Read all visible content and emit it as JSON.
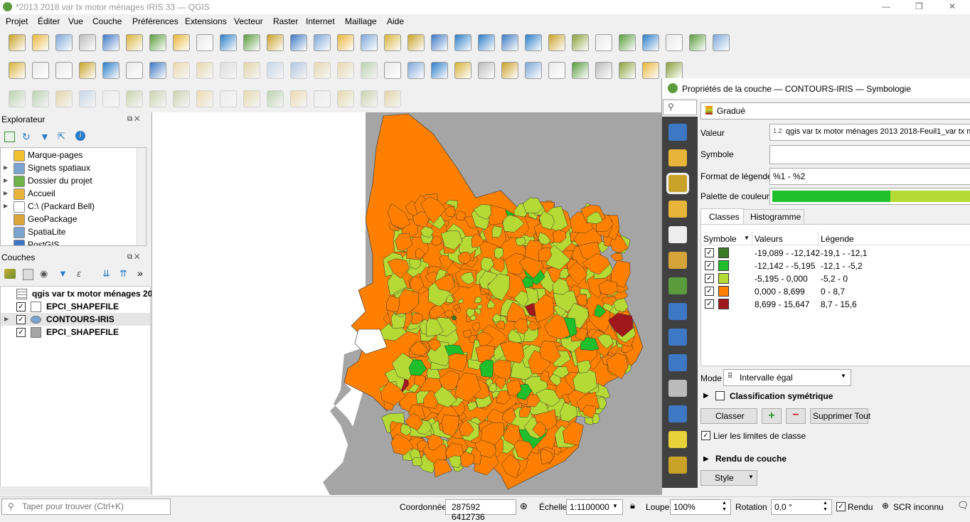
{
  "window": {
    "title": "*2013 2018 var tx motor ménages IRIS 33 — QGIS",
    "restore": "❐",
    "close": "✕"
  },
  "menu": [
    "Projet",
    "Éditer",
    "Vue",
    "Couche",
    "Préférences",
    "Extensions",
    "Vecteur",
    "Raster",
    "Internet",
    "Maillage",
    "Aide"
  ],
  "toolbar_icons": {
    "row1": [
      "new-project-icon",
      "open-project-icon",
      "save-project-icon",
      "save-as-icon",
      "print-layout-icon",
      "style-manager-icon",
      "pan-icon",
      "pan-to-selection-icon",
      "zoom-in-icon",
      "zoom-out-icon",
      "zoom-full-icon",
      "zoom-layer-icon",
      "zoom-selection-icon",
      "zoom-native-icon",
      "zoom-last-icon",
      "zoom-next-icon",
      "new-bookmark-icon",
      "show-bookmarks-icon",
      "map-tips-icon",
      "temporal-icon",
      "refresh-icon",
      "select-features-icon",
      "attribute-table-icon",
      "deselect-icon",
      "identify-icon",
      "statistics-icon",
      "sum-icon",
      "open-table-icon",
      "measure-icon",
      "annotation-icon",
      "gear-icon"
    ],
    "row2": [
      "datasource-manager-icon",
      "new-geopackage-icon",
      "new-shapefile-icon",
      "digitize-icon",
      "virtual-layer-icon",
      "temp-layer-icon",
      "mesh-layer-icon",
      "pencil-icon",
      "save-edits-icon",
      "add-feature-icon",
      "vertex-tool-icon",
      "cut-icon",
      "copy-icon",
      "paste-icon",
      "undo-icon",
      "redo-icon",
      "label-abc-icon",
      "diagram-icon",
      "label-pin-icon",
      "label-red-icon",
      "label-show-icon",
      "label-move-icon",
      "label-rotate-icon",
      "label-change-icon",
      "label-highlight-icon",
      "globe-icon",
      "globe2-icon",
      "python-icon",
      "help-icon"
    ],
    "row3": [
      "advanced-digitizing-icon",
      "add-ring-icon",
      "fill-ring-icon",
      "delete-ring-icon",
      "delete-part-icon",
      "reshape-icon",
      "offset-icon",
      "split-icon",
      "merge-icon",
      "rotate-icon",
      "simplify-icon",
      "add-part-icon",
      "split-parts-icon",
      "rotate-point-icon",
      "trim-icon",
      "reverse-icon",
      "angle-icon"
    ]
  },
  "explorer": {
    "title": "Explorateur",
    "items": [
      {
        "label": "Marque-pages",
        "icon": "star-icon",
        "expandable": false
      },
      {
        "label": "Signets spatiaux",
        "icon": "bookmark-icon",
        "expandable": true
      },
      {
        "label": "Dossier du projet",
        "icon": "project-folder-icon",
        "expandable": true
      },
      {
        "label": "Accueil",
        "icon": "home-folder-icon",
        "expandable": true
      },
      {
        "label": "C:\\ (Packard Bell)",
        "icon": "drive-icon",
        "expandable": true
      },
      {
        "label": "GeoPackage",
        "icon": "geopackage-icon",
        "expandable": false
      },
      {
        "label": "SpatiaLite",
        "icon": "spatialite-icon",
        "expandable": false
      },
      {
        "label": "PostGIS",
        "icon": "postgis-icon",
        "expandable": false
      }
    ]
  },
  "layers": {
    "title": "Couches",
    "more": "»",
    "items": [
      {
        "label": "qgis var tx motor ménages 20",
        "checked": false,
        "icon": "table-icon",
        "bold": true,
        "selected": false
      },
      {
        "label": "EPCI_SHAPEFILE",
        "checked": true,
        "icon": "empty-fill-icon",
        "bold": true,
        "selected": false
      },
      {
        "label": "CONTOURS-IRIS",
        "checked": true,
        "icon": "graduated-icon",
        "bold": true,
        "selected": true
      },
      {
        "label": "EPCI_SHAPEFILE",
        "checked": true,
        "icon": "gray-fill-icon",
        "bold": true,
        "selected": false
      }
    ]
  },
  "props": {
    "title": "Propriétés de la couche — CONTOURS-IRIS — Symbologie",
    "search_value": "",
    "renderer": "Gradué",
    "valeur_label": "Valeur",
    "valeur_prefix": "1.2",
    "valeur": "qgis var tx motor ménages 2013 2018-Feuil1_var tx m",
    "symbole_label": "Symbole",
    "format_label": "Format de légende",
    "format": "%1 - %2",
    "palette_label": "Palette de couleur",
    "tabs": [
      "Classes",
      "Histogramme"
    ],
    "columns": [
      "Symbole",
      "Valeurs",
      "Légende"
    ],
    "classes": [
      {
        "color": "#3b7a27",
        "values": "-19,089 - -12,142",
        "legend": "-19,1 - -12,1"
      },
      {
        "color": "#1ebf2a",
        "values": "-12,142 - -5,195",
        "legend": "-12,1 - -5,2"
      },
      {
        "color": "#b6da35",
        "values": "-5,195 - 0,000",
        "legend": "-5,2 - 0"
      },
      {
        "color": "#ff8000",
        "values": "0,000 - 8,699",
        "legend": "0 - 8,7"
      },
      {
        "color": "#a0181c",
        "values": "8,699 - 15,647",
        "legend": "8,7 - 15,6"
      }
    ],
    "mode_label": "Mode",
    "mode": "Intervalle égal",
    "symmetric": "Classification symétrique",
    "classify_btn": "Classer",
    "add_btn": "+",
    "remove_btn": "−",
    "delete_all_btn": "Supprimer Tout",
    "link_label": "Lier les limites de classe",
    "rendering": "Rendu de couche",
    "style_btn": "Style"
  },
  "status": {
    "search_placeholder": "Taper pour trouver (Ctrl+K)",
    "coord_label": "Coordonnée",
    "coord": "287592 6412736",
    "scale_label": "Échelle",
    "scale": "1:1100000",
    "magnifier_label": "Loupe",
    "magnifier": "100%",
    "rotation_label": "Rotation",
    "rotation": "0,0 °",
    "render_label": "Rendu",
    "crs": "SCR inconnu"
  },
  "colors": {
    "accent_green": "#5a9c3c",
    "map_gray": "#a5a5a5",
    "orange": "#ff8000",
    "yellow_green": "#b6da35",
    "sidebar_dark": "#404040"
  }
}
